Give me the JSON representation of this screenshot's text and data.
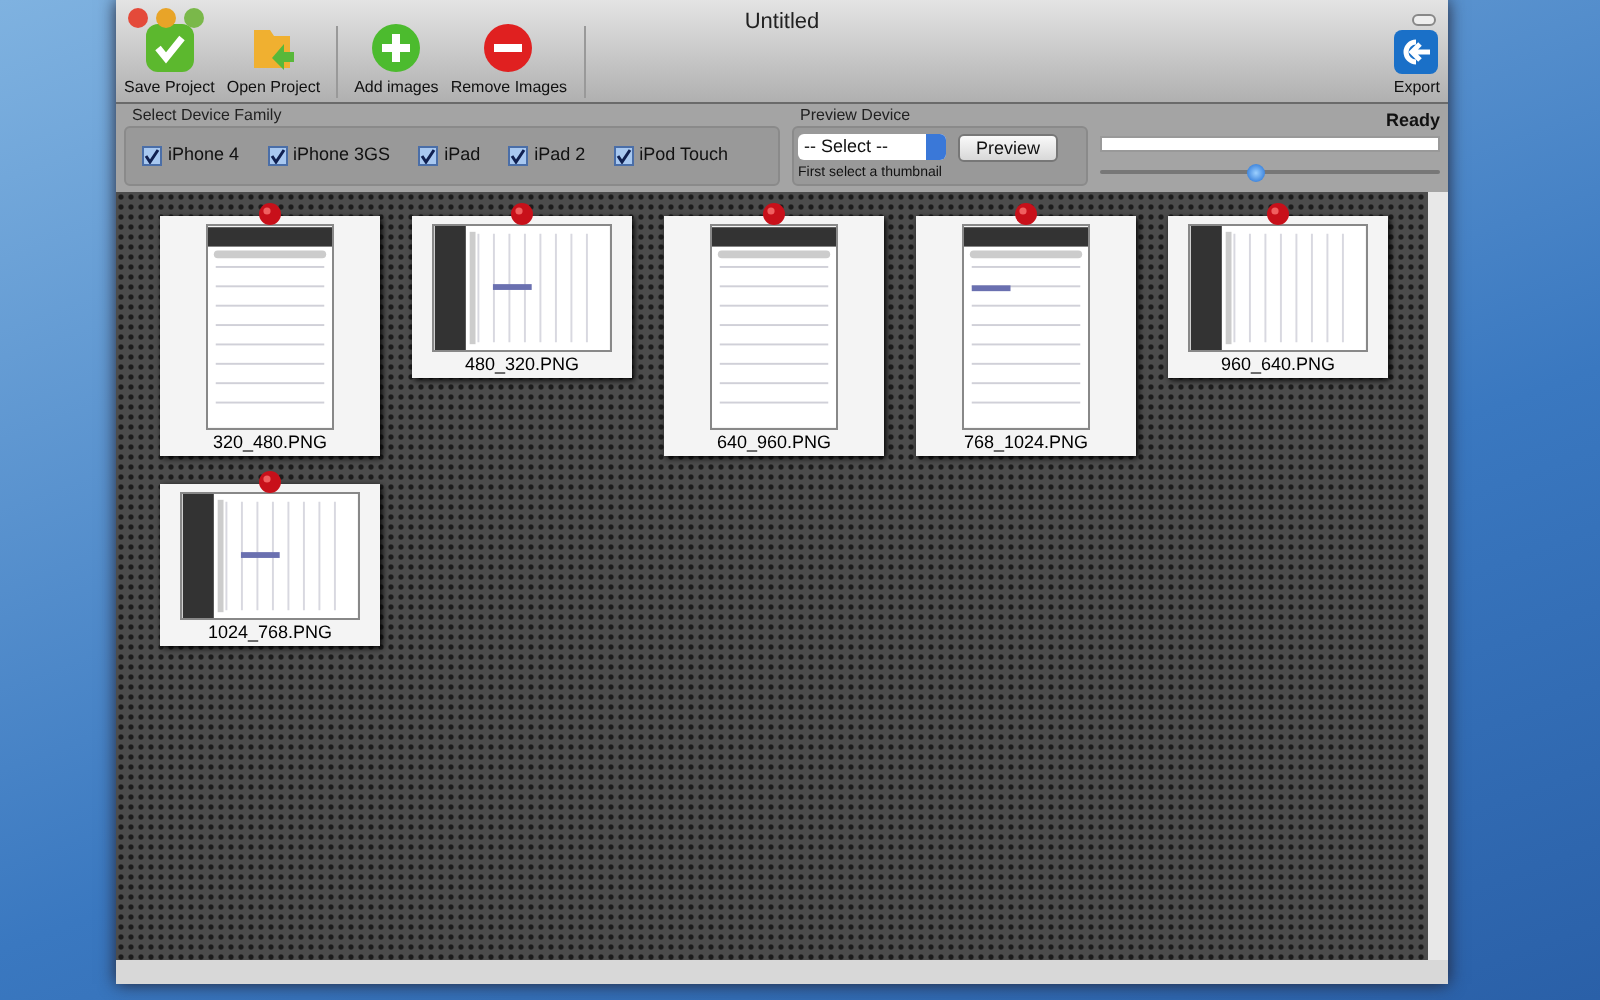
{
  "window": {
    "title": "Untitled"
  },
  "toolbar": [
    {
      "label": "Save Project",
      "kind": "save"
    },
    {
      "label": "Open Project",
      "kind": "open"
    },
    {
      "label": "Add images",
      "kind": "add"
    },
    {
      "label": "Remove Images",
      "kind": "remove"
    }
  ],
  "export_button": {
    "label": "Export"
  },
  "device_family": {
    "title": "Select Device Family",
    "devices": [
      {
        "label": "iPhone 4",
        "checked": true
      },
      {
        "label": "iPhone 3GS",
        "checked": true
      },
      {
        "label": "iPad",
        "checked": true
      },
      {
        "label": "iPad 2",
        "checked": true
      },
      {
        "label": "iPod Touch",
        "checked": true
      }
    ]
  },
  "preview_device": {
    "title": "Preview Device",
    "select": {
      "value": "-- Select --"
    },
    "button": "Preview",
    "hint": "First select a thumbnail"
  },
  "status": {
    "text": "Ready",
    "progress": {
      "level": 0
    },
    "zoom": {
      "level": 0.46
    }
  },
  "thumbnails": [
    {
      "filename": "320_480.PNG",
      "kind": "portrait"
    },
    {
      "filename": "480_320.PNG",
      "kind": "landscape"
    },
    {
      "filename": "640_960.PNG",
      "kind": "portrait"
    },
    {
      "filename": "768_1024.PNG",
      "kind": "portrait"
    },
    {
      "filename": "960_640.PNG",
      "kind": "landscape"
    },
    {
      "filename": "1024_768.PNG",
      "kind": "landscape"
    }
  ]
}
